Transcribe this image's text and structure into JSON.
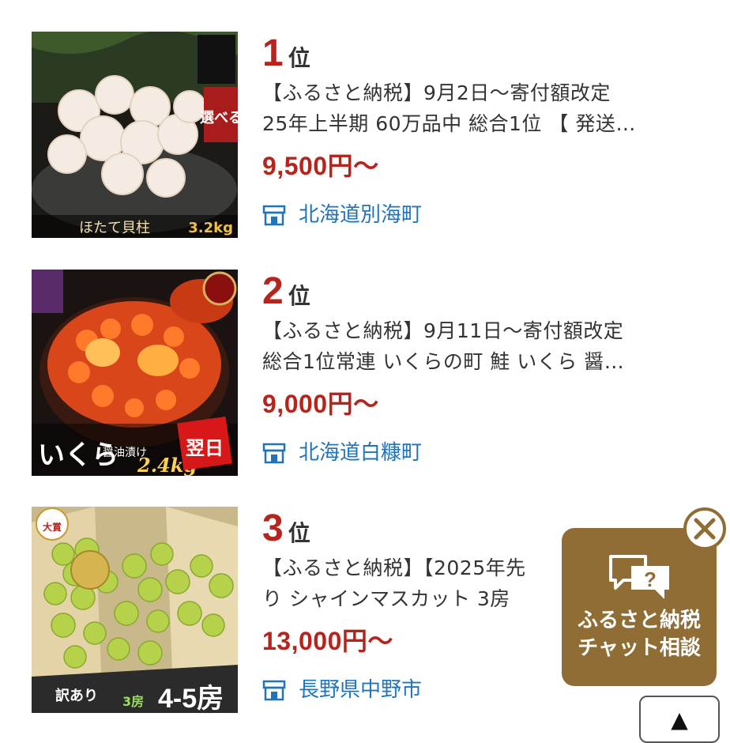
{
  "ranking": [
    {
      "rank": "1",
      "rank_suffix": "位",
      "title": "【ふるさと納税】9月2日〜寄付額改定\n25年上半期 60万品中 総合1位 【 発送…",
      "price": "9,500円〜",
      "location": "北海道別海町",
      "image_labels": {
        "badge": "選べる",
        "product": "ほたて貝柱",
        "weight": "3.2kg"
      }
    },
    {
      "rank": "2",
      "rank_suffix": "位",
      "title": "【ふるさと納税】9月11日〜寄付額改定\n総合1位常連 いくらの町 鮭 いくら 醤…",
      "price": "9,000円〜",
      "location": "北海道白糠町",
      "image_labels": {
        "product": "いくら",
        "sub": "醤油漬け",
        "weight": "2.4kg",
        "ship": "翌日"
      }
    },
    {
      "rank": "3",
      "rank_suffix": "位",
      "title": "【ふるさと納税】【2025年先\nり シャインマスカット 3房 ",
      "price": "13,000円〜",
      "location": "長野県中野市",
      "image_labels": {
        "award": "大賞",
        "label": "訳あり",
        "count_small": "3房",
        "count_big": "4-5房"
      }
    }
  ],
  "chat_widget": {
    "label_line1": "ふるさと納税",
    "label_line2": "チャット相談",
    "close_icon": "close-circle-icon",
    "icon": "chat-bubble-question-icon"
  },
  "scroll_top": {
    "symbol": "▲"
  },
  "colors": {
    "rank_red": "#b8241c",
    "price_red": "#b8241c",
    "location_blue": "#1f74bc",
    "chat_bg": "#8f6d34"
  }
}
